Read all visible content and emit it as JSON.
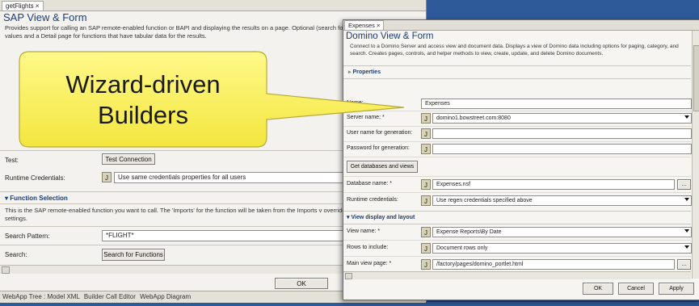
{
  "sap": {
    "tab": "getFlights",
    "tab_close": "×",
    "title": "SAP View & Form",
    "description": "Provides support for calling an SAP remote-enabled function or BAPI and displaying the results on a page. Optional (search form) for the function Import values and a Detail page for functions that have tabular data for the results.",
    "test_label": "Test:",
    "test_button": "Test Connection",
    "runtime_label": "Runtime Credentials:",
    "runtime_value": "Use same credentials properties for all users",
    "section_function": "Function Selection",
    "function_desc": "This is the SAP remote-enabled function you want to call. The 'Imports' for the function will be taken from the Imports v overridden by the Function Inputs settings.",
    "search_pattern_label": "Search Pattern:",
    "search_pattern_value": "*FLIGHT*",
    "search_label": "Search:",
    "search_button": "Search for Functions",
    "ok": "OK",
    "bottom_tabs": [
      "WebApp Tree : Model XML",
      "Builder Call Editor",
      "WebApp Diagram"
    ]
  },
  "domino": {
    "tab": "Expenses",
    "tab_close": "×",
    "title": "Domino View & Form",
    "description": "Connect to a Domino Server and access view and document data. Displays a view of Domino data including options for paging, category, and search. Creates pages, controls, and helper methods to view, create, update, and delete Domino documents.",
    "properties": "Properties",
    "name_label": "Name:",
    "name_value": "Expenses",
    "server_label": "Server name: *",
    "server_value": "domino1.bowstreet.com:8080",
    "user_label": "User name for generation:",
    "pass_label": "Password for generation:",
    "get_db_button": "Get databases and views",
    "db_label": "Database name: *",
    "db_value": "Expenses.nsf",
    "runtime_label": "Runtime credentials:",
    "runtime_value": "Use regen credentials specified above",
    "section_view": "View display and layout",
    "view_label": "View name: *",
    "view_value": "Expense Reports\\By Date",
    "rows_label": "Rows to include:",
    "rows_value": "Document rows only",
    "main_view_label": "Main view page: *",
    "main_view_value": "/factory/pages/domino_portlet.html",
    "ok": "OK",
    "cancel": "Cancel",
    "apply": "Apply",
    "ellipsis": "...",
    "j": "J"
  },
  "callout": {
    "line1": "Wizard-driven",
    "line2": "Builders"
  },
  "colors": {
    "background": "#2a5494",
    "callout_fill": "#fff56a",
    "title_blue": "#1b3d7a"
  }
}
